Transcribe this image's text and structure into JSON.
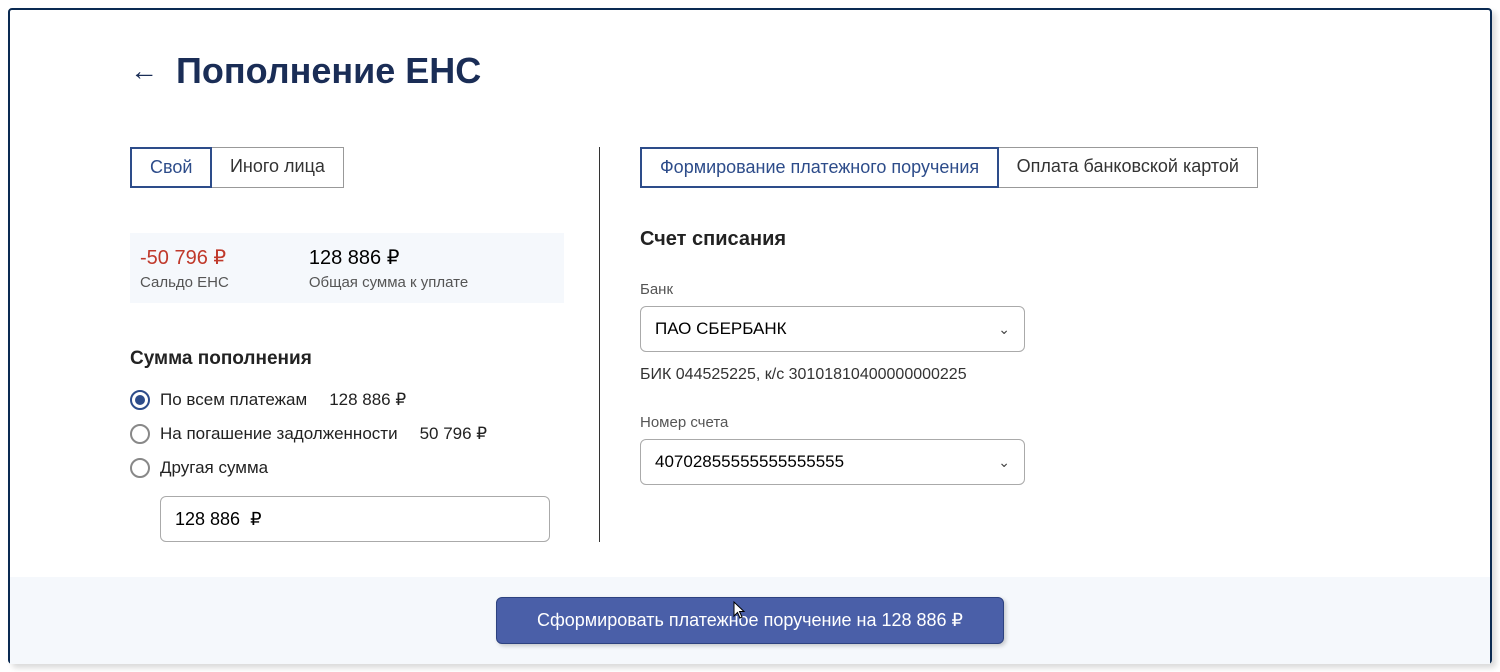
{
  "header": {
    "title": "Пополнение ЕНС"
  },
  "leftTabs": {
    "own": "Свой",
    "other": "Иного лица"
  },
  "balance": {
    "saldo_value": "-50 796 ₽",
    "saldo_label": "Сальдо ЕНС",
    "total_value": "128 886 ₽",
    "total_label": "Общая сумма к уплате"
  },
  "topup": {
    "heading": "Сумма пополнения",
    "opt_all_label": "По всем платежам",
    "opt_all_amount": "128 886 ₽",
    "opt_debt_label": "На погашение задолженности",
    "opt_debt_amount": "50 796 ₽",
    "opt_other_label": "Другая сумма",
    "input_value": "128 886  ₽"
  },
  "rightTabs": {
    "formation": "Формирование платежного поручения",
    "card": "Оплата банковской картой"
  },
  "debitAccount": {
    "heading": "Счет списания",
    "bank_label": "Банк",
    "bank_value": "ПАО СБЕРБАНК",
    "bank_details": "БИК 044525225, к/с 30101810400000000225",
    "account_label": "Номер счета",
    "account_value": "40702855555555555555"
  },
  "submit": {
    "label": "Сформировать платежное поручение на 128 886 ₽"
  }
}
